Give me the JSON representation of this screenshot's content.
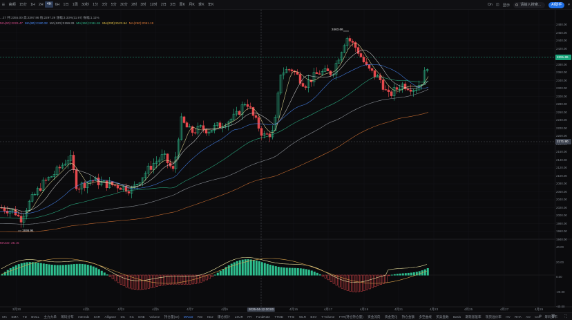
{
  "topbar": {
    "menu_icon": "menu-icon",
    "symbol_prefix": "...",
    "timeframes": [
      {
        "label": "高频",
        "active": false
      },
      {
        "label": "15分",
        "active": false
      },
      {
        "label": "1H",
        "active": false
      },
      {
        "label": "2H",
        "active": false
      },
      {
        "label": "4H",
        "active": true
      },
      {
        "label": "6H",
        "active": false
      },
      {
        "label": "1日",
        "active": false
      },
      {
        "label": "1周",
        "active": false
      },
      {
        "label": "30秒",
        "active": false
      },
      {
        "label": "1分",
        "active": false
      },
      {
        "label": "3分",
        "active": false
      },
      {
        "label": "5分",
        "active": false
      },
      {
        "label": "30分",
        "active": false
      },
      {
        "label": "2时",
        "active": false
      },
      {
        "label": "3时",
        "active": false
      },
      {
        "label": "12时",
        "active": false
      },
      {
        "label": "2日",
        "active": false
      },
      {
        "label": "3日",
        "active": false
      },
      {
        "label": "周K",
        "active": false
      },
      {
        "label": "月K",
        "active": false
      },
      {
        "label": "季K",
        "active": false
      },
      {
        "label": "年K",
        "active": false
      }
    ],
    "right": {
      "toggle_label": "On",
      "display_label": "显示",
      "search_placeholder": "请输入搜索...",
      "compare_label": "AI助手",
      "more_icon": "chevron-down-icon"
    }
  },
  "legend": {
    "line1": "...27  开:2355.00  高:2397.86  低:2297.29  涨幅:3.33%(11.97)  振幅:1.11%",
    "line2": [
      {
        "text": "MA(60):2226.47",
        "color": "#d64b8c"
      },
      {
        "text": "MA(90):2180.32",
        "color": "#4a8dff"
      },
      {
        "text": "MA(120):2159.39",
        "color": "#a0a6ad"
      },
      {
        "text": "MA(150):2111.84",
        "color": "#2fbf8f"
      },
      {
        "text": "MA(200):2123.54",
        "color": "#e8c547"
      },
      {
        "text": "MA(250):2061.19",
        "color": "#e07a36"
      }
    ],
    "macd": "MACD: 26.15"
  },
  "price_axis": {
    "ticks": [
      "2480.00",
      "2460.00",
      "2440.00",
      "2420.00",
      "2400.00",
      "2380.00",
      "2360.00",
      "2340.00",
      "2320.00",
      "2300.00",
      "2280.00",
      "2260.00",
      "2240.00",
      "2220.00",
      "2200.00",
      "2180.00",
      "2160.00",
      "2140.00",
      "2120.00",
      "2100.00",
      "2080.00",
      "2060.00",
      "2040.00",
      "2020.00",
      "2000.00",
      "1980.00",
      "1960.00",
      "1940.00"
    ],
    "last_price_tag": "2391.86",
    "last_price_color": "#1aa37a",
    "crosshair_tag": "2171.90",
    "crosshair_color": "#3d4350"
  },
  "macd_axis": {
    "ticks": [
      "40.00",
      "20.00",
      "0.00",
      "-20.00",
      "-40.00"
    ]
  },
  "annotations": {
    "high": "2463.66",
    "low": "1936.94"
  },
  "time_axis": {
    "labels": [
      "3月30",
      "4月1",
      "4月3",
      "4月5",
      "4月7",
      "4月9",
      "4月11",
      "2025-04-12 00:00",
      "4月15",
      "4月17",
      "4月19",
      "4月21",
      "4月23",
      "4月25",
      "4月27",
      "4月29"
    ]
  },
  "indicators": {
    "items": [
      "MA",
      "EMA",
      "TD",
      "BOLL",
      "主力大单",
      "筹码分布",
      "mtmndx",
      "SAR",
      "Alligator",
      "DC",
      "KC",
      "ENE",
      "",
      "Volume",
      "持仓量(OI)",
      "MACD",
      "RSI",
      "KDJ",
      "爆仓统计",
      "LSUR",
      "FR",
      "FundRate",
      "TTMD",
      "TTSI",
      "WLR",
      "BSV",
      "T-Volume",
      "FTR(持仓持仓量)",
      "资金流向",
      "资金变化",
      "持仓金额",
      "多空曲线",
      "买卖盘数",
      "Basis",
      "期现基差率",
      "现货溢价率",
      "HV",
      "RHA",
      "AO",
      "CCI",
      "筹码分布"
    ],
    "active": "MACD",
    "right_icons": [
      "settings-icon",
      "trash-icon",
      "fullscreen-icon"
    ]
  },
  "colors": {
    "up": "#2fbf8f",
    "down": "#e5484d",
    "background": "#0b0b0d"
  }
}
